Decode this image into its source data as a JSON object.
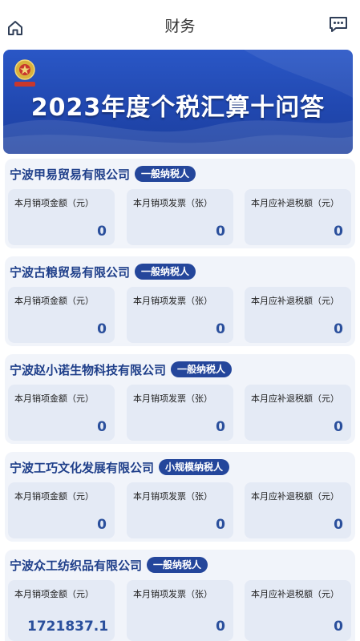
{
  "header": {
    "title": "财务"
  },
  "banner": {
    "title": "2023年度个税汇算十问答",
    "dots": 3,
    "active_dot": 1
  },
  "companies": [
    {
      "name": "宁波甲易贸易有限公司",
      "tax_type": "一般纳税人",
      "stats": [
        {
          "label": "本月销项金额（元）",
          "value": "0"
        },
        {
          "label": "本月销项发票（张）",
          "value": "0"
        },
        {
          "label": "本月应补退税额（元）",
          "value": "0"
        }
      ]
    },
    {
      "name": "宁波古粮贸易有限公司",
      "tax_type": "一般纳税人",
      "stats": [
        {
          "label": "本月销项金额（元）",
          "value": "0"
        },
        {
          "label": "本月销项发票（张）",
          "value": "0"
        },
        {
          "label": "本月应补退税额（元）",
          "value": "0"
        }
      ]
    },
    {
      "name": "宁波赵小诺生物科技有限公司",
      "tax_type": "一般纳税人",
      "stats": [
        {
          "label": "本月销项金额（元）",
          "value": "0"
        },
        {
          "label": "本月销项发票（张）",
          "value": "0"
        },
        {
          "label": "本月应补退税额（元）",
          "value": "0"
        }
      ]
    },
    {
      "name": "宁波工巧文化发展有限公司",
      "tax_type": "小规模纳税人",
      "stats": [
        {
          "label": "本月销项金额（元）",
          "value": "0"
        },
        {
          "label": "本月销项发票（张）",
          "value": "0"
        },
        {
          "label": "本月应补退税额（元）",
          "value": "0"
        }
      ]
    },
    {
      "name": "宁波众工纺织品有限公司",
      "tax_type": "一般纳税人",
      "stats": [
        {
          "label": "本月销项金额（元）",
          "value": "1721837.1"
        },
        {
          "label": "本月销项发票（张）",
          "value": "0"
        },
        {
          "label": "本月应补退税额（元）",
          "value": "0"
        }
      ]
    }
  ],
  "colors": {
    "brand_blue": "#24469b",
    "card_bg": "#f1f4fa",
    "stat_bg": "#e4eaf5",
    "value_blue": "#2a4f9c"
  }
}
